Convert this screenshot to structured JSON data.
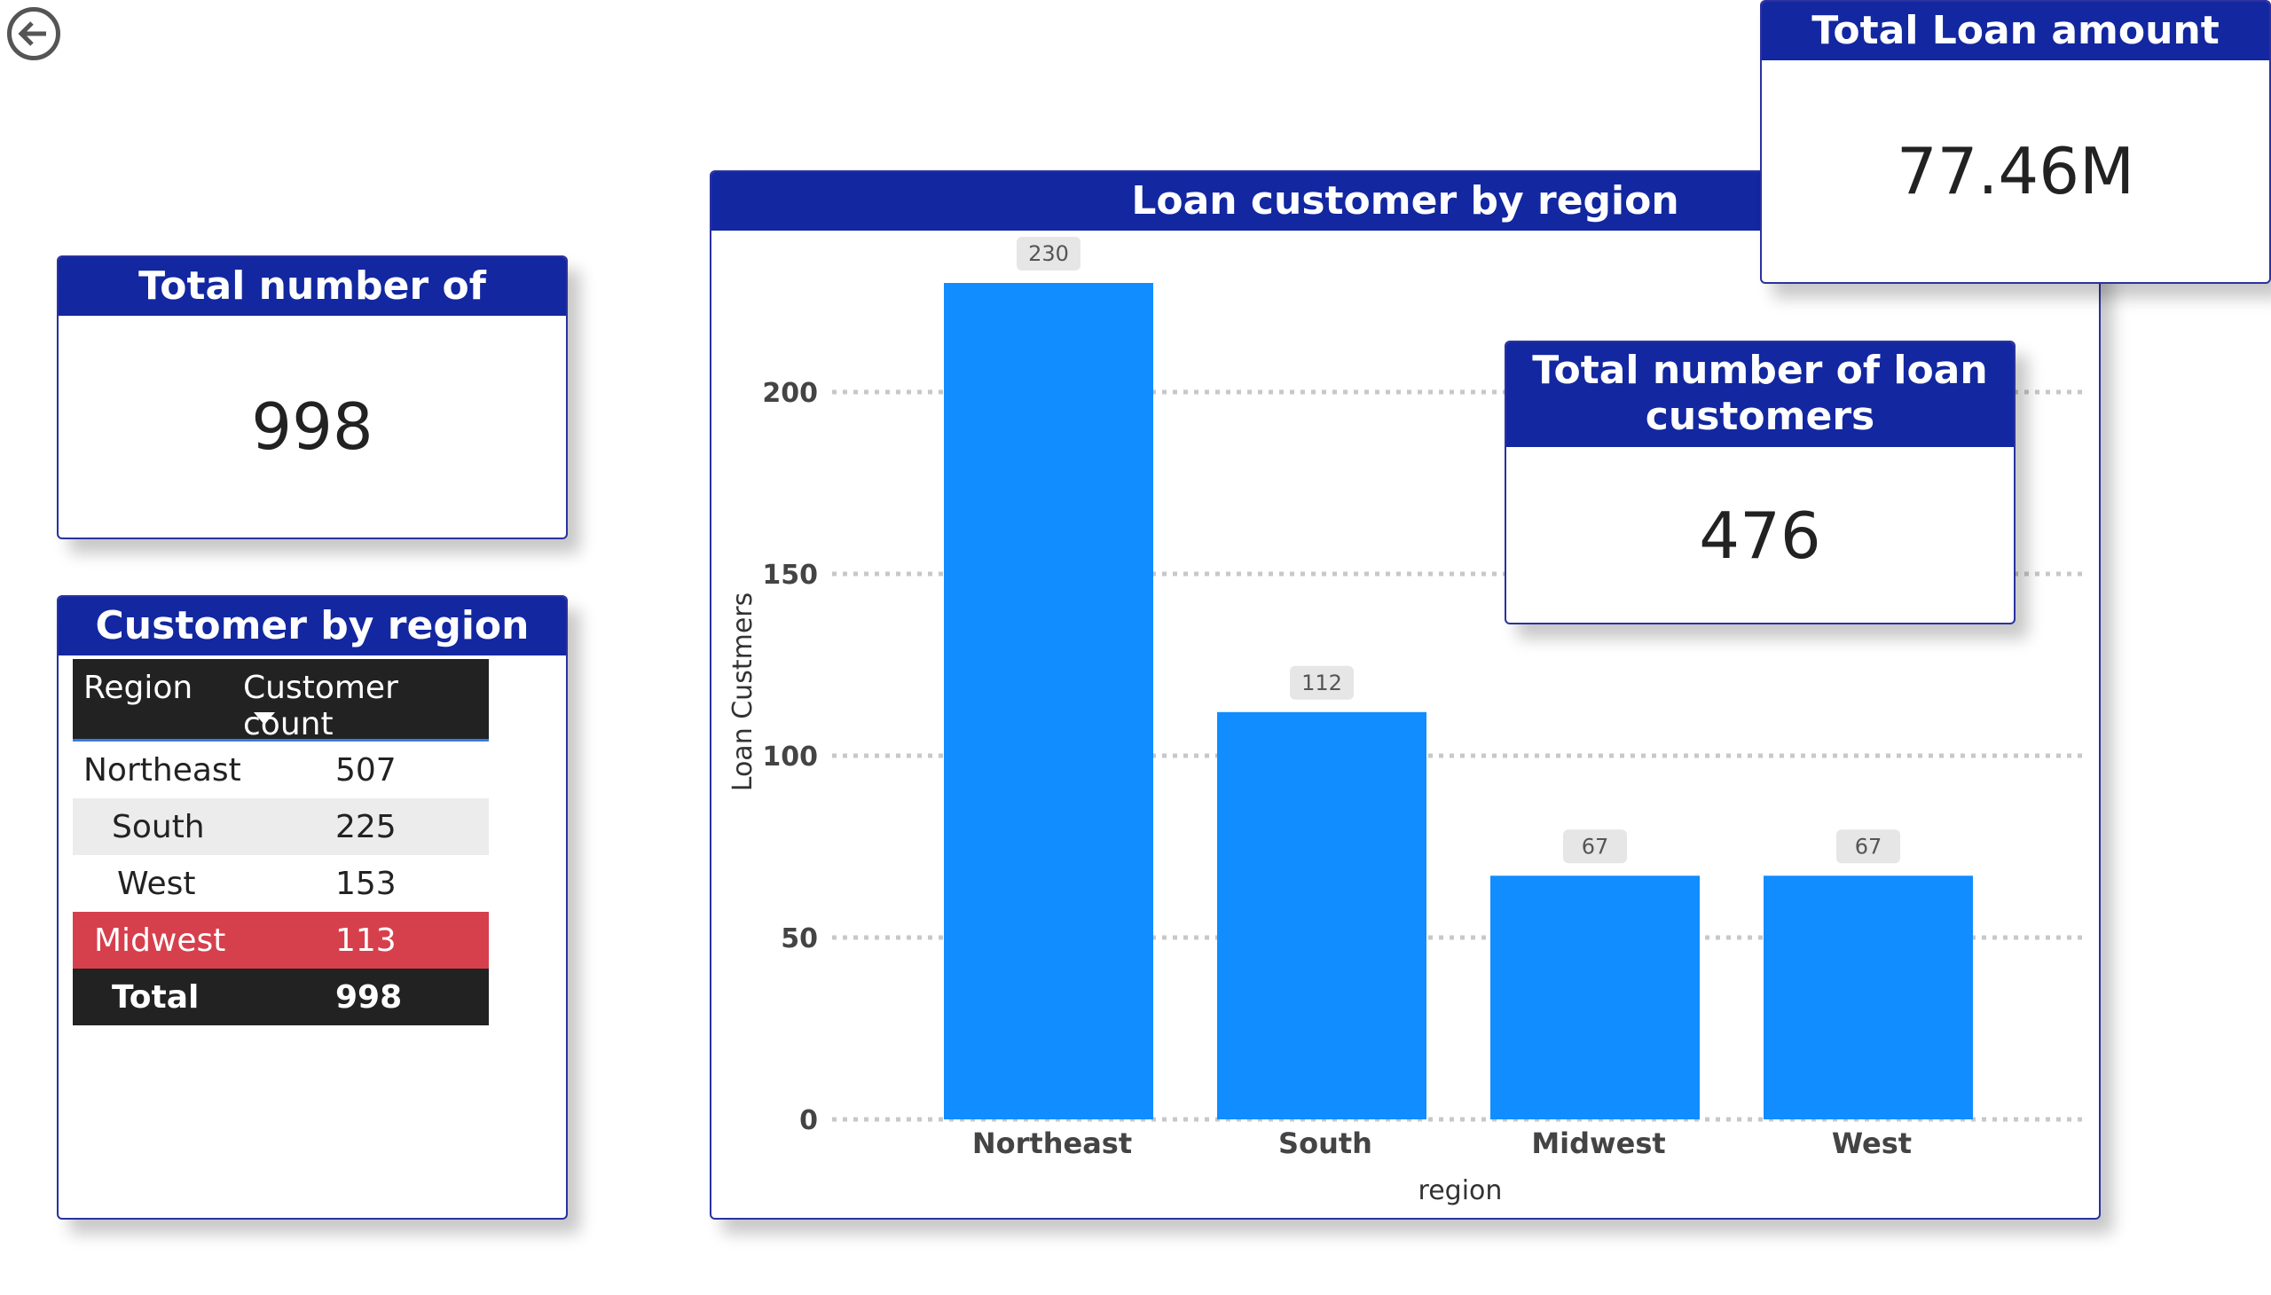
{
  "nav": {
    "back_icon": "arrow-left-circle-icon"
  },
  "colors": {
    "header": "#1227a0",
    "bar": "#118dff",
    "highlight_row": "#d6404c"
  },
  "kpi_customers": {
    "title": "Total number of customers",
    "value": "998"
  },
  "customer_table": {
    "title": "Customer by region",
    "headers": [
      "Region",
      "Customer count"
    ],
    "rows": [
      {
        "region": "Northeast",
        "count": "507"
      },
      {
        "region": "South",
        "count": "225"
      },
      {
        "region": "West",
        "count": "153"
      },
      {
        "region": "Midwest",
        "count": "113"
      }
    ],
    "total": {
      "label": "Total",
      "value": "998"
    }
  },
  "chart_card": {
    "title": "Loan customer by region"
  },
  "kpi_loan_amount": {
    "title": "Total Loan amount",
    "value": "77.46M"
  },
  "kpi_loan_customers": {
    "title_line1": "Total number of loan",
    "title_line2": "customers",
    "value": "476"
  },
  "chart_data": {
    "type": "bar",
    "title": "Loan customer by region",
    "categories": [
      "Northeast",
      "South",
      "Midwest",
      "West"
    ],
    "values": [
      230,
      112,
      67,
      67
    ],
    "xlabel": "region",
    "ylabel": "Loan Custmers",
    "ylim": [
      0,
      230
    ],
    "yticks": [
      0,
      50,
      100,
      150,
      200
    ],
    "grid": true,
    "data_labels": true
  }
}
